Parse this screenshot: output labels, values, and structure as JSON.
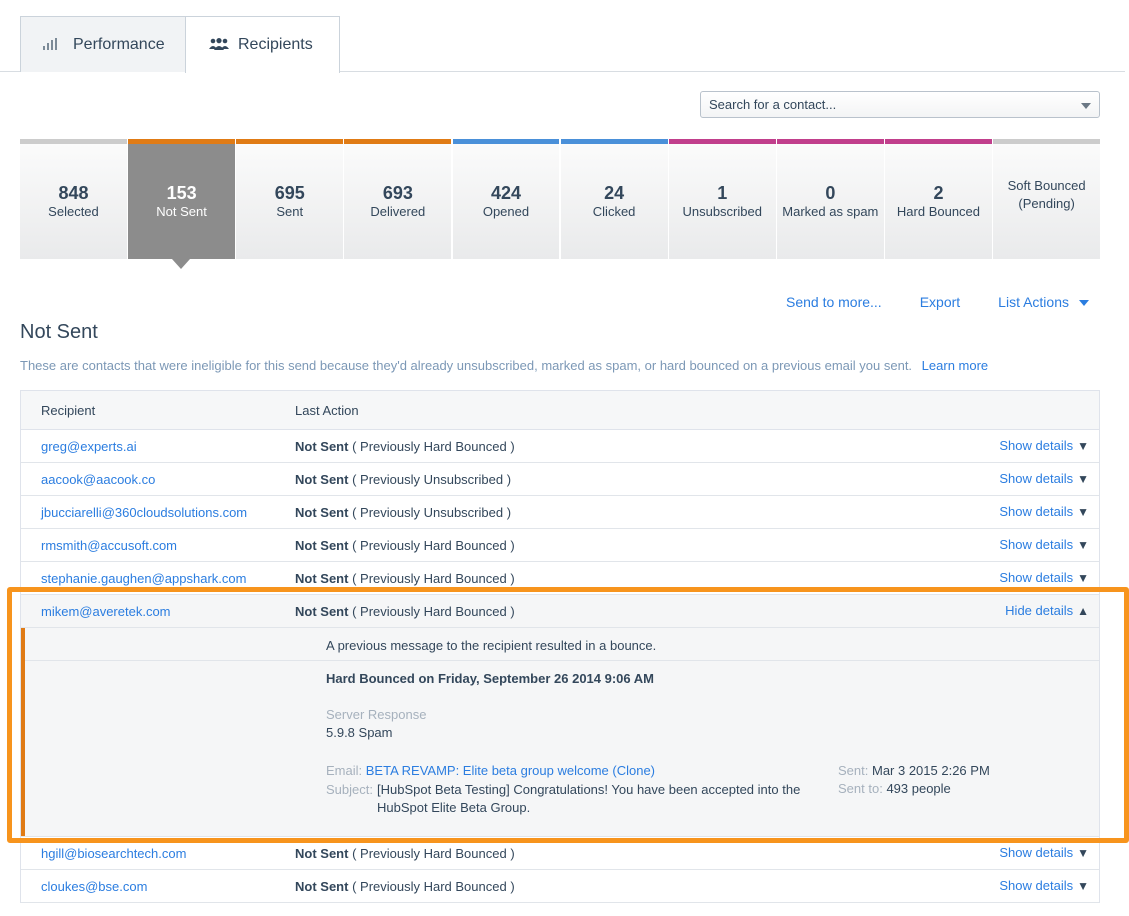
{
  "tabs": [
    {
      "label": "Performance"
    },
    {
      "label": "Recipients"
    }
  ],
  "search": {
    "value": "Search for a contact..."
  },
  "stats": [
    {
      "num": "848",
      "label": "Selected",
      "color": "#cccccc"
    },
    {
      "num": "153",
      "label": "Not Sent",
      "color": "#e07b15"
    },
    {
      "num": "695",
      "label": "Sent",
      "color": "#e07b15"
    },
    {
      "num": "693",
      "label": "Delivered",
      "color": "#e07b15"
    },
    {
      "num": "424",
      "label": "Opened",
      "color": "#4a90d9"
    },
    {
      "num": "24",
      "label": "Clicked",
      "color": "#4a90d9"
    },
    {
      "num": "1",
      "label": "Unsubscribed",
      "color": "#c13f8c"
    },
    {
      "num": "0",
      "label": "Marked as spam",
      "color": "#c13f8c"
    },
    {
      "num": "2",
      "label": "Hard Bounced",
      "color": "#c13f8c"
    },
    {
      "num": "",
      "label": "Soft Bounced (Pending)",
      "color": "#cccccc"
    }
  ],
  "actions": {
    "send_more": "Send to more...",
    "export": "Export",
    "list_actions": "List Actions"
  },
  "section": {
    "title": "Not Sent",
    "description": "These are contacts that were ineligible for this send because they'd already unsubscribed, marked as spam, or hard bounced on a previous email you sent.",
    "learn_more": "Learn more"
  },
  "table": {
    "headers": {
      "recipient": "Recipient",
      "last_action": "Last Action"
    },
    "rows": [
      {
        "email": "greg@experts.ai",
        "status": "Not Sent",
        "reason": "( Previously Hard Bounced )",
        "toggle": "Show details"
      },
      {
        "email": "aacook@aacook.co",
        "status": "Not Sent",
        "reason": "( Previously Unsubscribed )",
        "toggle": "Show details"
      },
      {
        "email": "jbucciarelli@360cloudsolutions.com",
        "status": "Not Sent",
        "reason": "( Previously Unsubscribed )",
        "toggle": "Show details"
      },
      {
        "email": "rmsmith@accusoft.com",
        "status": "Not Sent",
        "reason": "( Previously Hard Bounced )",
        "toggle": "Show details"
      },
      {
        "email": "stephanie.gaughen@appshark.com",
        "status": "Not Sent",
        "reason": "( Previously Hard Bounced )",
        "toggle": "Show details"
      },
      {
        "email": "mikem@averetek.com",
        "status": "Not Sent",
        "reason": "( Previously Hard Bounced )",
        "toggle": "Hide details"
      },
      {
        "email": "hgill@biosearchtech.com",
        "status": "Not Sent",
        "reason": "( Previously Hard Bounced )",
        "toggle": "Show details"
      },
      {
        "email": "cloukes@bse.com",
        "status": "Not Sent",
        "reason": "( Previously Hard Bounced )",
        "toggle": "Show details"
      }
    ],
    "detail": {
      "message": "A previous message to the recipient resulted in a bounce.",
      "hard_bounced": "Hard Bounced on Friday, September 26 2014 9:06 AM",
      "server_response_label": "Server Response",
      "server_response_value": "5.9.8 Spam",
      "email_label": "Email:",
      "email_value": "BETA REVAMP: Elite beta group welcome (Clone)",
      "subject_label": "Subject:",
      "subject_value": "[HubSpot Beta Testing] Congratulations! You have been accepted into the HubSpot Elite Beta Group.",
      "sent_label": "Sent:",
      "sent_value": "Mar 3 2015 2:26 PM",
      "sent_to_label": "Sent to:",
      "sent_to_value": "493 people"
    }
  }
}
